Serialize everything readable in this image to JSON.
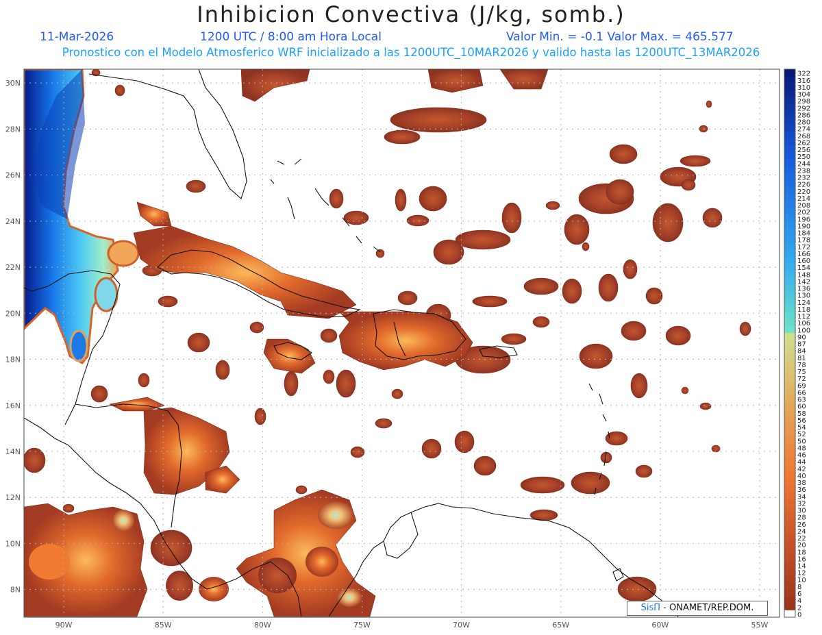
{
  "header": {
    "title": "Inhibicion Convectiva (J/kg, somb.)",
    "date": "11-Mar-2026",
    "time": "1200 UTC / 8:00 am Hora Local",
    "minmax": "Valor Min. = -0.1  Valor Max. = 465.577",
    "subtitle": "Pronostico con el Modelo Atmosferico WRF inicializado a las 1200UTC_10MAR2026 y valido hasta las  1200UTC_13MAR2026"
  },
  "map": {
    "lon_labels": [
      "90W",
      "85W",
      "80W",
      "75W",
      "70W",
      "65W",
      "60W",
      "55W"
    ],
    "lat_labels": [
      "30N",
      "28N",
      "26N",
      "24N",
      "22N",
      "20N",
      "18N",
      "16N",
      "14N",
      "12N",
      "10N",
      "8N"
    ],
    "lon_range": [
      -92,
      -54
    ],
    "lat_range": [
      6.8,
      30.6
    ]
  },
  "colorbar": {
    "labels": [
      "322",
      "316",
      "310",
      "304",
      "298",
      "292",
      "286",
      "280",
      "274",
      "268",
      "262",
      "256",
      "250",
      "244",
      "238",
      "232",
      "226",
      "220",
      "214",
      "208",
      "202",
      "196",
      "190",
      "184",
      "178",
      "172",
      "166",
      "160",
      "154",
      "148",
      "142",
      "136",
      "130",
      "124",
      "118",
      "112",
      "106",
      "100",
      "90",
      "87",
      "84",
      "81",
      "78",
      "75",
      "72",
      "69",
      "66",
      "63",
      "60",
      "58",
      "56",
      "54",
      "52",
      "50",
      "48",
      "46",
      "44",
      "42",
      "40",
      "38",
      "36",
      "34",
      "32",
      "30",
      "28",
      "26",
      "24",
      "22",
      "20",
      "18",
      "16",
      "14",
      "12",
      "10",
      "8",
      "6",
      "4",
      "2",
      "0"
    ]
  },
  "credit": {
    "brand": "SisΠ",
    "text": " - ONAMET/REP.DOM."
  },
  "colors": {
    "field": "#9e3a22",
    "field_light": "#c8642e",
    "field_peak": "#e58a3a",
    "high_light": "#7fe5c6",
    "high_mid": "#25a7f0",
    "high_dark": "#0a2a9a",
    "coast": "#111111",
    "grid": "#b0b0b0"
  }
}
